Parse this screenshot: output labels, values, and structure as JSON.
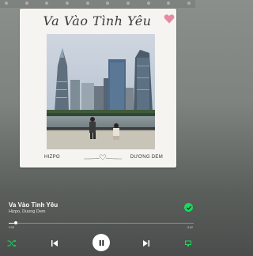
{
  "album": {
    "script_title": "Va Vào Tình Yêu",
    "artist_left": "HIZPO",
    "artist_right": "DƯƠNG DEM"
  },
  "song": {
    "title": "Va Vào Tình Yêu",
    "artists": "Hizpo, Duong Dem",
    "liked": true
  },
  "progress": {
    "fraction": 0.04,
    "elapsed": "0:05",
    "total": "-3:42"
  },
  "controls": {
    "shuffle_icon": "shuffle-icon",
    "prev_icon": "skip-previous-icon",
    "play_icon": "pause-icon",
    "next_icon": "skip-next-icon",
    "device_icon": "connect-device-icon"
  },
  "colors": {
    "accent": "#1ed760",
    "heart": "#e98aa1"
  }
}
